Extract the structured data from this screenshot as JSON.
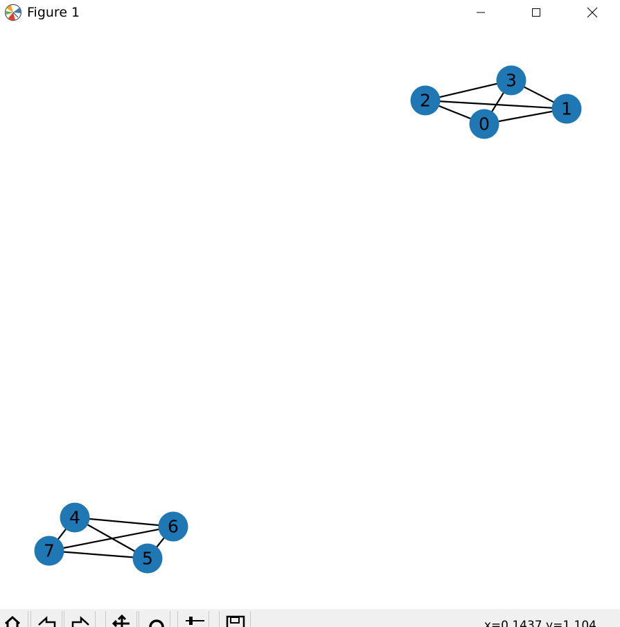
{
  "window": {
    "title": "Figure 1"
  },
  "graph": {
    "node_color": "#1f77b4",
    "edge_color": "#000000",
    "label_color": "#000000",
    "nodes": [
      {
        "id": "0",
        "label": "0"
      },
      {
        "id": "1",
        "label": "1"
      },
      {
        "id": "2",
        "label": "2"
      },
      {
        "id": "3",
        "label": "3"
      },
      {
        "id": "4",
        "label": "4"
      },
      {
        "id": "5",
        "label": "5"
      },
      {
        "id": "6",
        "label": "6"
      },
      {
        "id": "7",
        "label": "7"
      }
    ],
    "edges": [
      [
        "0",
        "1"
      ],
      [
        "0",
        "2"
      ],
      [
        "0",
        "3"
      ],
      [
        "1",
        "2"
      ],
      [
        "1",
        "3"
      ],
      [
        "2",
        "3"
      ],
      [
        "4",
        "5"
      ],
      [
        "4",
        "6"
      ],
      [
        "4",
        "7"
      ],
      [
        "5",
        "6"
      ],
      [
        "5",
        "7"
      ],
      [
        "6",
        "7"
      ]
    ]
  },
  "toolbar": {
    "buttons": [
      {
        "name": "home-button",
        "icon": "home-icon"
      },
      {
        "name": "back-button",
        "icon": "back-arrow-icon"
      },
      {
        "name": "forward-button",
        "icon": "forward-arrow-icon"
      },
      {
        "name": "pan-button",
        "icon": "pan-arrows-icon"
      },
      {
        "name": "zoom-button",
        "icon": "zoom-magnifier-icon"
      },
      {
        "name": "configure-subplots-button",
        "icon": "sliders-icon"
      },
      {
        "name": "save-button",
        "icon": "save-disk-icon"
      }
    ],
    "coordinates": "x=0.1437 y=1.104"
  }
}
